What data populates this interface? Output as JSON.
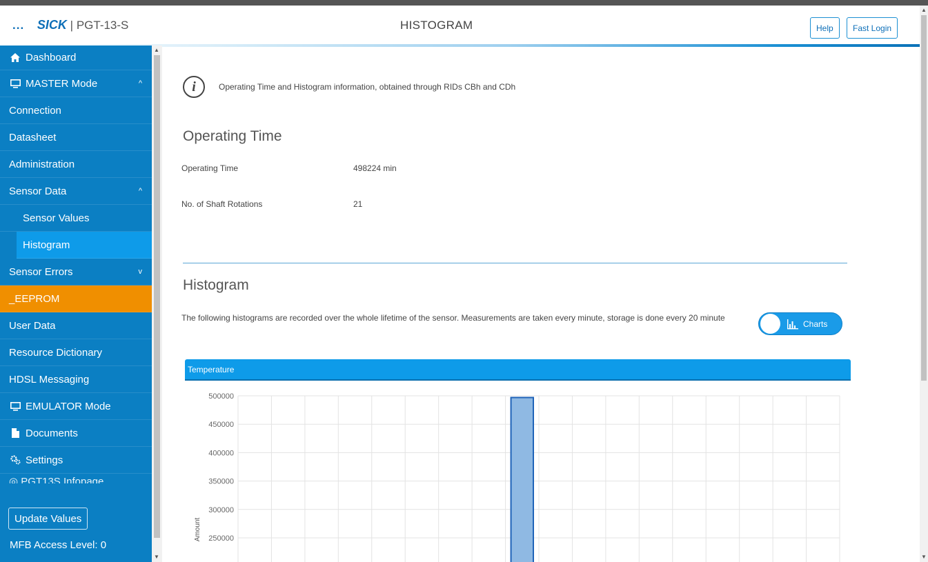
{
  "header": {
    "menu_dots": "...",
    "brand": "SICK",
    "separator": "|",
    "device": "PGT-13-S",
    "title": "HISTOGRAM",
    "help_label": "Help",
    "fast_login_label": "Fast Login"
  },
  "sidebar": {
    "items": [
      {
        "label": "Dashboard",
        "icon": "home-icon"
      },
      {
        "label": "MASTER Mode",
        "icon": "monitor-icon",
        "caret": "^"
      },
      {
        "label": "Connection"
      },
      {
        "label": "Datasheet"
      },
      {
        "label": "Administration"
      },
      {
        "label": "Sensor Data",
        "caret": "^"
      },
      {
        "label": "Sensor Values"
      },
      {
        "label": "Histogram"
      },
      {
        "label": "Sensor Errors",
        "caret": "v"
      },
      {
        "label": "_EEPROM"
      },
      {
        "label": "User Data"
      },
      {
        "label": "Resource Dictionary"
      },
      {
        "label": "HDSL Messaging"
      },
      {
        "label": "EMULATOR Mode",
        "icon": "monitor-icon"
      },
      {
        "label": "Documents",
        "icon": "document-icon"
      },
      {
        "label": "Settings",
        "icon": "gears-icon"
      },
      {
        "label": "PGT13S Infopage",
        "icon": "info-circle-icon"
      }
    ],
    "update_values_label": "Update Values",
    "access_level": "MFB Access Level: 0"
  },
  "main": {
    "info_text": "Operating Time and Histogram information, obtained through RIDs CBh and CDh",
    "operating_time_heading": "Operating Time",
    "operating_time_label": "Operating Time",
    "operating_time_value": "498224 min",
    "shaft_rotations_label": "No. of Shaft Rotations",
    "shaft_rotations_value": "21",
    "histogram_heading": "Histogram",
    "histogram_description": "The following histograms are recorded over the whole lifetime of the sensor. Measurements are taken every minute, storage is done every 20 minute",
    "toggle_label": "Charts",
    "panel_title": "Temperature"
  },
  "colors": {
    "sidebar": "#0b7fc3",
    "active_item": "#0e9be9",
    "eeprom_item": "#f08f00",
    "accent": "#0e9be9",
    "bar_fill": "#8fb9e3",
    "bar_stroke": "#1f63b8"
  },
  "chart_data": {
    "type": "bar",
    "title": "Temperature",
    "ylabel": "Amount",
    "xlabel": "",
    "ylim_visible": [
      250000,
      500000
    ],
    "y_ticks": [
      500000,
      450000,
      400000,
      350000,
      300000,
      250000
    ],
    "bin_count": 18,
    "values": [
      0,
      0,
      0,
      0,
      0,
      0,
      0,
      0,
      497000,
      0,
      0,
      0,
      0,
      0,
      0,
      0,
      0,
      0
    ],
    "grid": true
  }
}
